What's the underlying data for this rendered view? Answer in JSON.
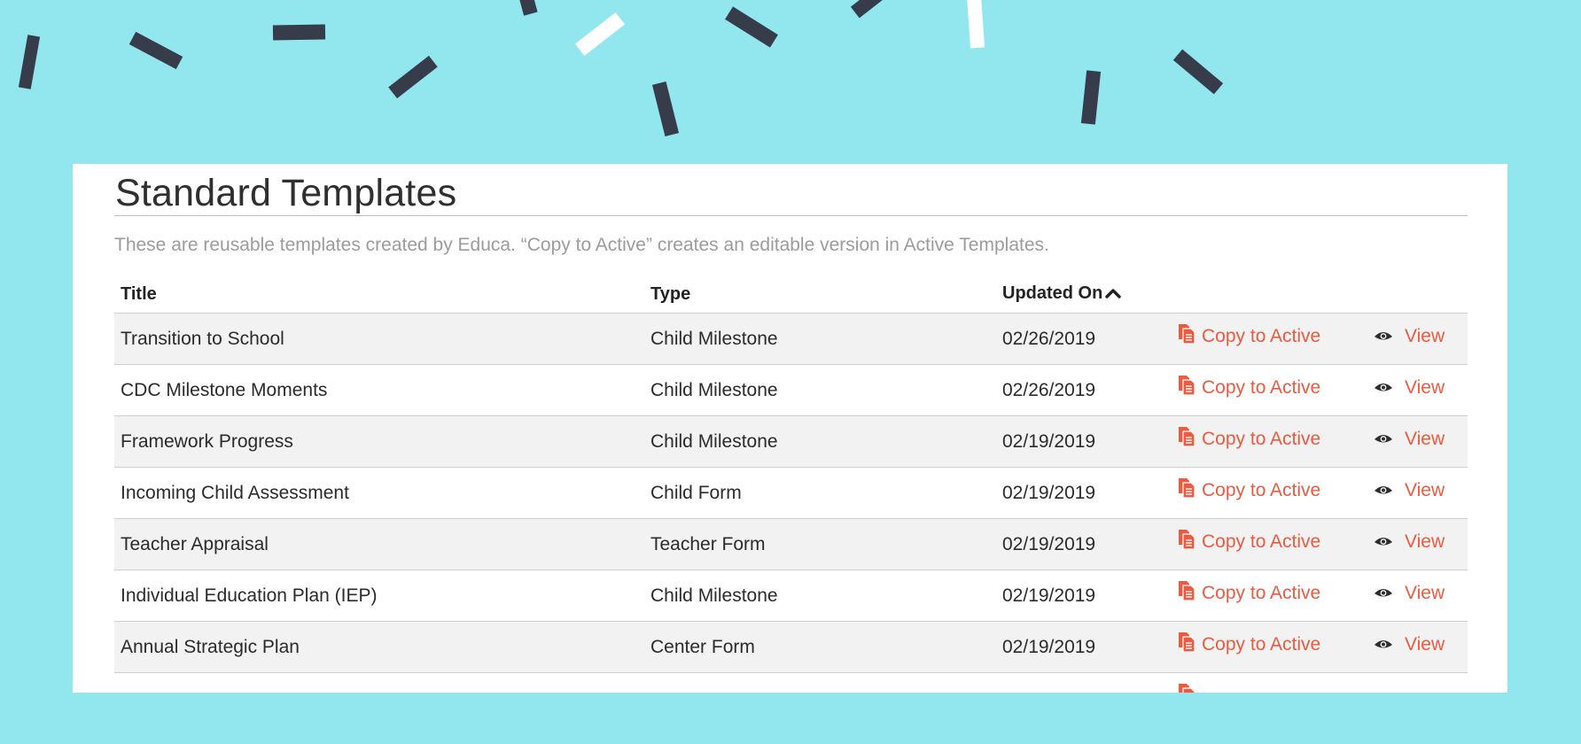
{
  "page": {
    "title": "Standard Templates",
    "description": "These are reusable templates created by Educa. “Copy to Active” creates an editable version in Active Templates."
  },
  "table": {
    "columns": {
      "title": "Title",
      "type": "Type",
      "updated_on": "Updated On"
    },
    "sort": {
      "column": "updated_on",
      "direction": "ascending",
      "icon": "caret-up-icon"
    },
    "action_labels": {
      "copy": "Copy to Active",
      "view": "View"
    },
    "rows": [
      {
        "title": "Transition to School",
        "type": "Child Milestone",
        "updated": "02/26/2019"
      },
      {
        "title": "CDC Milestone Moments",
        "type": "Child Milestone",
        "updated": "02/26/2019"
      },
      {
        "title": "Framework Progress",
        "type": "Child Milestone",
        "updated": "02/19/2019"
      },
      {
        "title": "Incoming Child Assessment",
        "type": "Child Form",
        "updated": "02/19/2019"
      },
      {
        "title": "Teacher Appraisal",
        "type": "Teacher Form",
        "updated": "02/19/2019"
      },
      {
        "title": "Individual Education Plan (IEP)",
        "type": "Child Milestone",
        "updated": "02/19/2019"
      },
      {
        "title": "Annual Strategic Plan",
        "type": "Center Form",
        "updated": "02/19/2019"
      }
    ]
  },
  "colors": {
    "background": "#92e7ee",
    "confetti_dark": "#363c49",
    "confetti_light": "#ffffff",
    "accent": "#ea5b41",
    "row_alt": "#f2f2f2"
  },
  "icons": {
    "copy": "copy-documents-icon",
    "view": "eye-icon"
  }
}
